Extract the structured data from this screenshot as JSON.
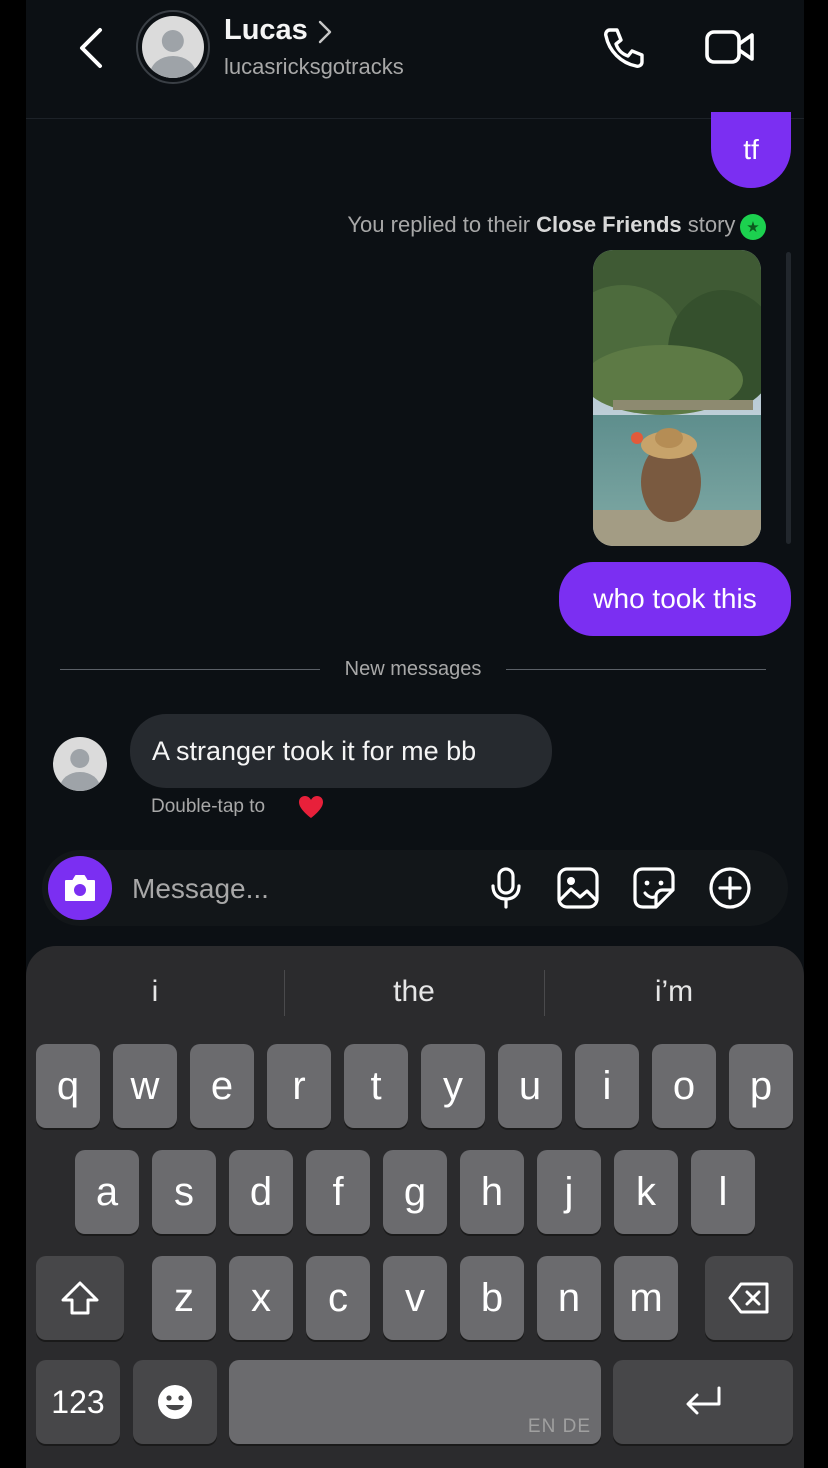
{
  "header": {
    "name": "Lucas",
    "username": "lucasricksgotracks",
    "icons": [
      "back-arrow-icon",
      "chevron-right-icon",
      "phone-icon",
      "video-camera-icon"
    ]
  },
  "messages": {
    "out_1": "tf",
    "reply_note_prefix": "You replied to their ",
    "reply_note_bold": "Close Friends",
    "reply_note_suffix": " story",
    "out_2": "who took this",
    "divider": "New messages",
    "in_1": "A stranger took it for me bb",
    "double_tap": "Double-tap to"
  },
  "composer": {
    "placeholder": "Message...",
    "icons": [
      "camera-icon",
      "microphone-icon",
      "gallery-icon",
      "sticker-icon",
      "plus-circle-icon"
    ]
  },
  "keyboard": {
    "suggestions": [
      "i",
      "the",
      "i’m"
    ],
    "row1": [
      "q",
      "w",
      "e",
      "r",
      "t",
      "y",
      "u",
      "i",
      "o",
      "p"
    ],
    "row2": [
      "a",
      "s",
      "d",
      "f",
      "g",
      "h",
      "j",
      "k",
      "l"
    ],
    "row3": [
      "z",
      "x",
      "c",
      "v",
      "b",
      "n",
      "m"
    ],
    "numbers_label": "123",
    "space_lang": "EN DE"
  },
  "colors": {
    "accent_purple": "#7b2ff2",
    "background": "#0c1014",
    "incoming_bubble": "#262a2f",
    "close_friends_green": "#1cd14f"
  }
}
